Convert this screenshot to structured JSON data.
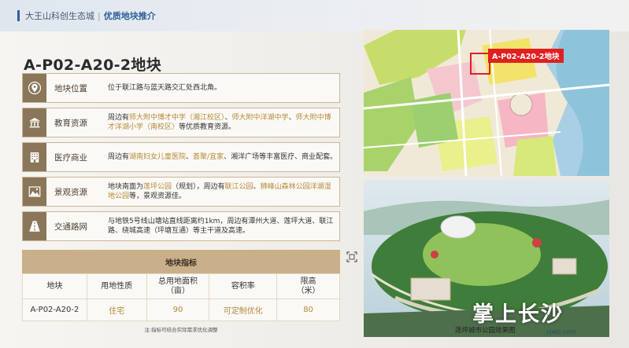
{
  "header": {
    "breadcrumb_root": "大王山科创生态城",
    "separator": "|",
    "breadcrumb_current": "优质地块推介"
  },
  "title": "A-P02-A20-2地块",
  "rows": [
    {
      "icon": "location-pin-icon",
      "label": "地块位置",
      "content": [
        {
          "t": "位于联江路与蓝天路交汇处西北角。",
          "hl": false
        }
      ]
    },
    {
      "icon": "school-building-icon",
      "label": "教育资源",
      "content": [
        {
          "t": "周边有",
          "hl": false
        },
        {
          "t": "师大附中博才中学（湘江校区）",
          "hl": true
        },
        {
          "t": "、",
          "hl": false
        },
        {
          "t": "师大附中洋湖中学",
          "hl": true
        },
        {
          "t": "、",
          "hl": false
        },
        {
          "t": "师大附中博才洋湖小学（南校区）",
          "hl": true
        },
        {
          "t": "等优质教育资源。",
          "hl": false
        }
      ]
    },
    {
      "icon": "hospital-building-icon",
      "label": "医疗商业",
      "content": [
        {
          "t": "周边有",
          "hl": false
        },
        {
          "t": "湖南妇女儿童医院",
          "hl": true
        },
        {
          "t": "、",
          "hl": false
        },
        {
          "t": "荟聚/宜家",
          "hl": true
        },
        {
          "t": "、湘洋广场等丰富医疗、商业配套。",
          "hl": false
        }
      ]
    },
    {
      "icon": "mountain-landscape-icon",
      "label": "景观资源",
      "content": [
        {
          "t": "地块南面为",
          "hl": false
        },
        {
          "t": "莲坪公园",
          "hl": true
        },
        {
          "t": "（规划），周边有",
          "hl": false
        },
        {
          "t": "联江公园",
          "hl": true
        },
        {
          "t": "、",
          "hl": false
        },
        {
          "t": "狮峰山森林公园洋湖湿地公园",
          "hl": true
        },
        {
          "t": "等，景观资源佳。",
          "hl": false
        }
      ]
    },
    {
      "icon": "road-icon",
      "label": "交通路网",
      "content": [
        {
          "t": "与地铁5号线山塘站直线距离约1km，周边有潭州大道、莲坪大道、联江路、绕城高速（坪塘互通）等主干道及高速。",
          "hl": false
        }
      ]
    }
  ],
  "indicator_table": {
    "title": "地块指标",
    "headers": [
      "地块",
      "用地性质",
      "总用地面积\n（亩）",
      "容积率",
      "限高\n（米）"
    ],
    "row": [
      "A-P02-A20-2",
      "住宅",
      "90",
      "可定制优化",
      "80"
    ],
    "note": "注:指标可结合实际需求优化调整"
  },
  "map": {
    "tag": "A-P02-A20-2地块"
  },
  "park": {
    "caption": "莲坪城市公园效果图"
  },
  "watermark": {
    "text": "掌上长沙",
    "url": "cjwb.com"
  },
  "colors": {
    "accent_blue": "#2f5f9a",
    "brown": "#8a7658",
    "gold_text": "#b48a3b",
    "table_header": "#c9b08a",
    "tag_red": "#e02020"
  }
}
